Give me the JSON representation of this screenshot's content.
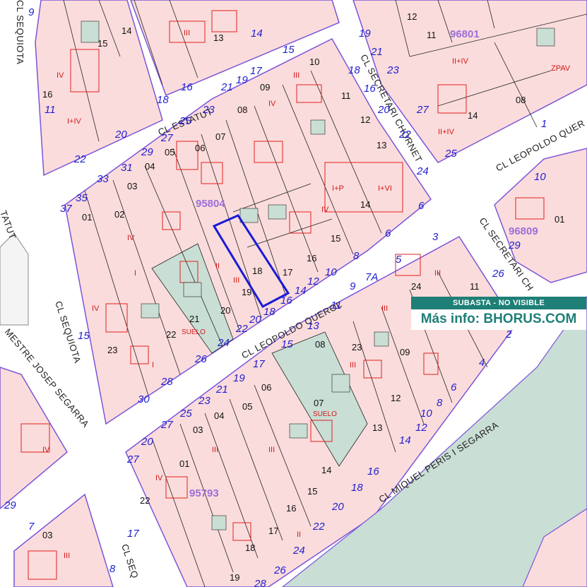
{
  "map": {
    "streets": {
      "estatut": "CL ESTATUT",
      "secretari_chornet": "CL SECRETARI CHORNET",
      "leopoldo_querol": "CL LEOPOLDO QUEROL",
      "leopoldo_querol_right": "CL LEOPOLDO QUER",
      "secretari_right": "CL SECRETARI CH",
      "sequiota_top": "CL SEQUIOTA",
      "sequiota_mid": "CL SEQUIOTA",
      "sequiota_bottom": "CL SEQ",
      "mestre": "MESTRE JOSEP SEGARRA",
      "miquel": "CL MIQUEL PERIS I SEGARRA",
      "estatut_left": "TATUT"
    },
    "block_refs": {
      "r95804": "95804",
      "r96801": "96801",
      "r96809": "96809",
      "r95793": "95793"
    },
    "banner": {
      "status": "SUBASTA - NO VISIBLE",
      "info": "Más info: BHORUS.COM"
    },
    "suelo": "SUELO",
    "colors": {
      "parcel_fill": "#fbdcdc",
      "block_outline": "#7a55d9",
      "building_outline": "#e02020",
      "street_number": "#1f1fd0",
      "green_area": "#c9ded4",
      "highlight": "#1a1ad6",
      "banner": "#1e7f77"
    },
    "highlighted_parcel": "18",
    "parcels": {
      "p14a": "14",
      "p15a": "15",
      "p16a": "16",
      "p13a": "13",
      "p10": "10",
      "p09": "09",
      "p11": "11",
      "p08": "08",
      "p12": "12",
      "p07": "07",
      "p13b": "13",
      "p05": "05",
      "p06": "06",
      "p04": "04",
      "p14b": "14",
      "p03": "03",
      "p01": "01",
      "p02": "02",
      "p15b": "15",
      "p16b": "16",
      "p17": "17",
      "p18": "18",
      "p19": "19",
      "p20": "20",
      "p21": "21",
      "p22": "22",
      "p23": "23",
      "p12c": "12",
      "p11c": "11",
      "p08c": "08",
      "p14c": "14",
      "p01c": "01",
      "p24": "24",
      "p11d": "11",
      "p09d": "09",
      "p12d": "12",
      "p13d": "13",
      "p08d": "08",
      "p23d": "23",
      "p06e": "06",
      "p05e": "05",
      "p07e": "07",
      "p04e": "04",
      "p03e": "03",
      "p01e": "01",
      "p22e": "22",
      "p14e": "14",
      "p15e": "15",
      "p16e": "16",
      "p17e": "17",
      "p18e": "18",
      "p19e": "19",
      "p03f": "03"
    },
    "street_numbers": {
      "n14": "14",
      "n15": "15",
      "n16": "16",
      "n18": "18",
      "n17": "17",
      "n19": "19",
      "n21": "21",
      "n23": "23",
      "n25": "25",
      "n27": "27",
      "n29": "29",
      "n31": "31",
      "n33": "33",
      "n35": "35",
      "n37": "37",
      "n20": "20",
      "n22": "22",
      "n24": "24",
      "n6a": "6",
      "n6b": "6",
      "n8": "8",
      "n10": "10",
      "n12": "12",
      "n14b": "14",
      "n16b": "16",
      "n18b": "18",
      "n20b": "20",
      "n22b": "22",
      "n24b": "24",
      "n26": "26",
      "n28": "28",
      "n30": "30",
      "n9": "9",
      "n7A": "7A",
      "n5": "5",
      "n3": "3",
      "n11": "11",
      "n13": "13",
      "n15b": "15",
      "n17b": "17",
      "n19b": "19",
      "n21b": "21",
      "n23b": "23",
      "n25b": "25",
      "n27b": "27",
      "n27c": "27",
      "n20c": "20",
      "n16c": "16",
      "n18c": "18",
      "n20d": "20",
      "n22c": "22",
      "n24c": "24",
      "n26c": "26",
      "n28c": "28",
      "n14c": "14",
      "n12c": "12",
      "n10c": "10",
      "n8c": "8",
      "n6c": "6",
      "n4": "4",
      "n2": "2",
      "n1": "1",
      "n15c": "15",
      "n17c": "17",
      "n19c": "19",
      "n21c": "21",
      "n23c": "23",
      "n25c": "25",
      "n27d": "27",
      "n29b": "29",
      "n26d": "26",
      "n29c": "29",
      "n10d": "10",
      "n8d": "8",
      "n7": "7",
      "n17d": "17",
      "n11b": "11",
      "n9b": "9"
    }
  }
}
